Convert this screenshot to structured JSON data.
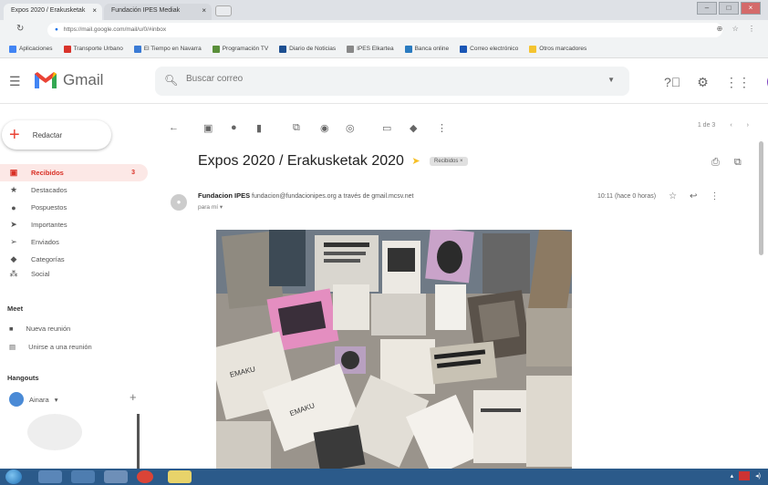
{
  "browser": {
    "tabs": [
      {
        "label": "Expos 2020 / Erakusketak",
        "active": true
      },
      {
        "label": "Fundación IPES Mediak",
        "active": false
      }
    ],
    "address": "https://mail.google.com/mail/u/0/#inbox",
    "bookmarks": [
      "Aplicaciones",
      "Transporte Urbano",
      "El Tiempo en Navarra",
      "Programación TV",
      "Diario de Noticias",
      "IPES Elkartea",
      "Banca online",
      "Correo electrónico",
      "Otros marcadores"
    ]
  },
  "gmail": {
    "app_name": "Gmail",
    "search_placeholder": "Buscar correo",
    "avatar_letter": "A",
    "accent": "#d93025"
  },
  "sidebar": {
    "compose_label": "Redactar",
    "items": [
      {
        "label": "Recibidos",
        "icon": "inbox-icon",
        "count": "3",
        "active": true
      },
      {
        "label": "Destacados",
        "icon": "star-icon"
      },
      {
        "label": "Pospuestos",
        "icon": "clock-icon"
      },
      {
        "label": "Importantes",
        "icon": "important-icon"
      },
      {
        "label": "Enviados",
        "icon": "send-icon"
      },
      {
        "label": "Categorías",
        "icon": "label-icon"
      },
      {
        "label": "Social",
        "icon": "people-icon"
      }
    ],
    "meet_title": "Meet",
    "meet_items": [
      "Nueva reunión",
      "Unirse a una reunión"
    ],
    "hangouts_title": "Hangouts",
    "hangouts_user": "Ainara"
  },
  "toolbar": {
    "pager": "1 de 3"
  },
  "message": {
    "subject": "Expos 2020 / Erakusketak 2020",
    "label": "Recibidos ×",
    "sender_name": "Fundacion IPES",
    "sender_email": "fundacion@fundacionipes.org a través de gmail.mcsv.net",
    "to": "para mí",
    "time": "10:11 (hace 0 horas)"
  }
}
